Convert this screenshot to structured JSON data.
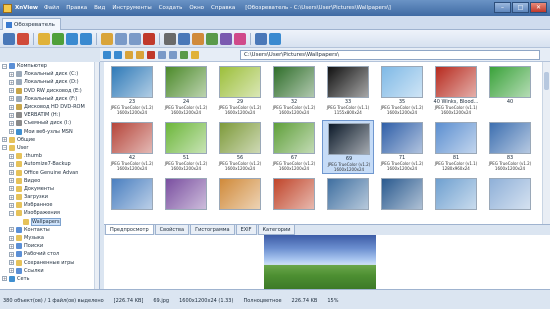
{
  "app": {
    "name": "XnView",
    "window_title": "[Обозреватель - C:\\Users\\User\\Pictures\\Wallpapers\\]"
  },
  "menu": [
    "Файл",
    "Правка",
    "Вид",
    "Инструменты",
    "Создать",
    "Окно",
    "Справка"
  ],
  "tab": {
    "label": "Обозреватель"
  },
  "address": {
    "value": "C:\\Users\\User\\Pictures\\Wallpapers\\"
  },
  "tree": [
    {
      "label": "Компьютер",
      "exp": "−",
      "icon": "#5b8fd6"
    },
    {
      "label": "Локальный диск (C:)",
      "exp": "+",
      "icon": "#9aa8b8"
    },
    {
      "label": "Локальный диск (D:)",
      "exp": "+",
      "icon": "#9aa8b8"
    },
    {
      "label": "DVD RW дисковод (E:)",
      "exp": "+",
      "icon": "#c9a64a"
    },
    {
      "label": "Локальный диск (F:)",
      "exp": "+",
      "icon": "#9aa8b8"
    },
    {
      "label": "Дисковод HD DVD-ROM",
      "exp": "+",
      "icon": "#c9a64a"
    },
    {
      "label": "VERBATIM (H:)",
      "exp": "+",
      "icon": "#8a8a8a"
    },
    {
      "label": "Съемный диск (I:)",
      "exp": "+",
      "icon": "#8a8a8a"
    },
    {
      "label": "Мои веб-узлы MSN",
      "exp": "+",
      "icon": "#3f8fd0"
    },
    {
      "label": "Общие",
      "exp": "+",
      "icon": "#e6c25a"
    },
    {
      "label": "User",
      "exp": "−",
      "icon": "#e6c25a"
    },
    {
      "label": ".thumb",
      "exp": "+",
      "icon": "#e6c25a"
    },
    {
      "label": "Automize7-Backup",
      "exp": "+",
      "icon": "#e6c25a"
    },
    {
      "label": "Office Genuine Advan",
      "exp": "+",
      "icon": "#e6c25a"
    },
    {
      "label": "Видео",
      "exp": "+",
      "icon": "#e6c25a"
    },
    {
      "label": "Документы",
      "exp": "+",
      "icon": "#e6c25a"
    },
    {
      "label": "Загрузки",
      "exp": "+",
      "icon": "#e6c25a"
    },
    {
      "label": "Избранное",
      "exp": "+",
      "icon": "#e6c25a"
    },
    {
      "label": "Изображения",
      "exp": "−",
      "icon": "#e6c25a"
    },
    {
      "label": "Wallpapers",
      "exp": "",
      "icon": "#e6c25a"
    },
    {
      "label": "Контакты",
      "exp": "+",
      "icon": "#5b8fd6"
    },
    {
      "label": "Музыка",
      "exp": "+",
      "icon": "#e6c25a"
    },
    {
      "label": "Поиски",
      "exp": "+",
      "icon": "#5b8fd6"
    },
    {
      "label": "Рабочий стол",
      "exp": "+",
      "icon": "#5b8fd6"
    },
    {
      "label": "Сохраненные игры",
      "exp": "+",
      "icon": "#e6c25a"
    },
    {
      "label": "Ссылки",
      "exp": "+",
      "icon": "#5b8fd6"
    },
    {
      "label": "Сеть",
      "exp": "+",
      "icon": "#3f8fd0"
    }
  ],
  "thumbnails": [
    {
      "num": "23",
      "cap1": "JPEG TrueColor (v1.2)",
      "cap2": "1600x1200x24",
      "color": "#2f7ab8"
    },
    {
      "num": "24",
      "cap1": "JPEG TrueColor (v1.2)",
      "cap2": "1600x1200x24",
      "color": "#4c8a2a"
    },
    {
      "num": "29",
      "cap1": "JPEG TrueColor (v1.2)",
      "cap2": "1600x1200x24",
      "color": "#9cbf3b"
    },
    {
      "num": "32",
      "cap1": "JPEG TrueColor (v1.2)",
      "cap2": "1600x1200x24",
      "color": "#2f6e2a"
    },
    {
      "num": "33",
      "cap1": "JPEG TrueColor (v1.1)",
      "cap2": "1155x800x24",
      "color": "#111111"
    },
    {
      "num": "35",
      "cap1": "JPEG TrueColor (v1.2)",
      "cap2": "1600x1200x24",
      "color": "#7fb9e6"
    },
    {
      "num": "40 Winks, Blood...",
      "cap1": "JPEG TrueColor (v1.1)",
      "cap2": "1600x1200x24",
      "color": "#b72a1e"
    },
    {
      "num": "40",
      "cap1": "",
      "cap2": "",
      "color": "#3aa23a"
    },
    {
      "num": "42",
      "cap1": "JPEG TrueColor (v1.2)",
      "cap2": "1600x1200x24",
      "color": "#b5453a"
    },
    {
      "num": "51",
      "cap1": "JPEG TrueColor (v1.2)",
      "cap2": "1600x1200x24",
      "color": "#6cb63a"
    },
    {
      "num": "56",
      "cap1": "JPEG TrueColor (v1.2)",
      "cap2": "1600x1200x24",
      "color": "#7d9a3a"
    },
    {
      "num": "67",
      "cap1": "JPEG TrueColor (v1.2)",
      "cap2": "1600x1200x24",
      "color": "#5f9f3a"
    },
    {
      "num": "69",
      "cap1": "JPEG TrueColor (v1.2)",
      "cap2": "1600x1200x24",
      "color": "#0c1a2a"
    },
    {
      "num": "71",
      "cap1": "JPEG TrueColor (v1.2)",
      "cap2": "1600x1200x24",
      "color": "#2f5fa8"
    },
    {
      "num": "81",
      "cap1": "JPEG TrueColor (v1.1)",
      "cap2": "1280x960x24",
      "color": "#5c8fd0"
    },
    {
      "num": "83",
      "cap1": "JPEG TrueColor (v1.2)",
      "cap2": "1600x1200x24",
      "color": "#3d6fb0"
    },
    {
      "num": "",
      "cap1": "",
      "cap2": "",
      "color": "#4a7fc0"
    },
    {
      "num": "",
      "cap1": "",
      "cap2": "",
      "color": "#7a4fa0"
    },
    {
      "num": "",
      "cap1": "",
      "cap2": "",
      "color": "#d08a3a"
    },
    {
      "num": "",
      "cap1": "",
      "cap2": "",
      "color": "#c0452a"
    },
    {
      "num": "",
      "cap1": "",
      "cap2": "",
      "color": "#3f6fa0"
    },
    {
      "num": "",
      "cap1": "",
      "cap2": "",
      "color": "#2a5a8f"
    },
    {
      "num": "",
      "cap1": "",
      "cap2": "",
      "color": "#6fa0d0"
    },
    {
      "num": "",
      "cap1": "",
      "cap2": "",
      "color": "#8fb0d8"
    }
  ],
  "selected_thumbnail": 12,
  "preview_tabs": [
    "Предпросмотр",
    "Свойства",
    "Гистограмма",
    "EXIF",
    "Категории"
  ],
  "status": {
    "objects": "380 объект(ов) / 1 файл(ов) выделено",
    "size1": "[226.74 KB]",
    "file": "69.jpg",
    "dims": "1600x1200x24 (1.33)",
    "mode": "Полноцветное",
    "size2": "226.74 KB",
    "zoom": "15%"
  },
  "colors": {
    "title_bar": "#3f6aa3",
    "selection": "#c6dcf7"
  }
}
